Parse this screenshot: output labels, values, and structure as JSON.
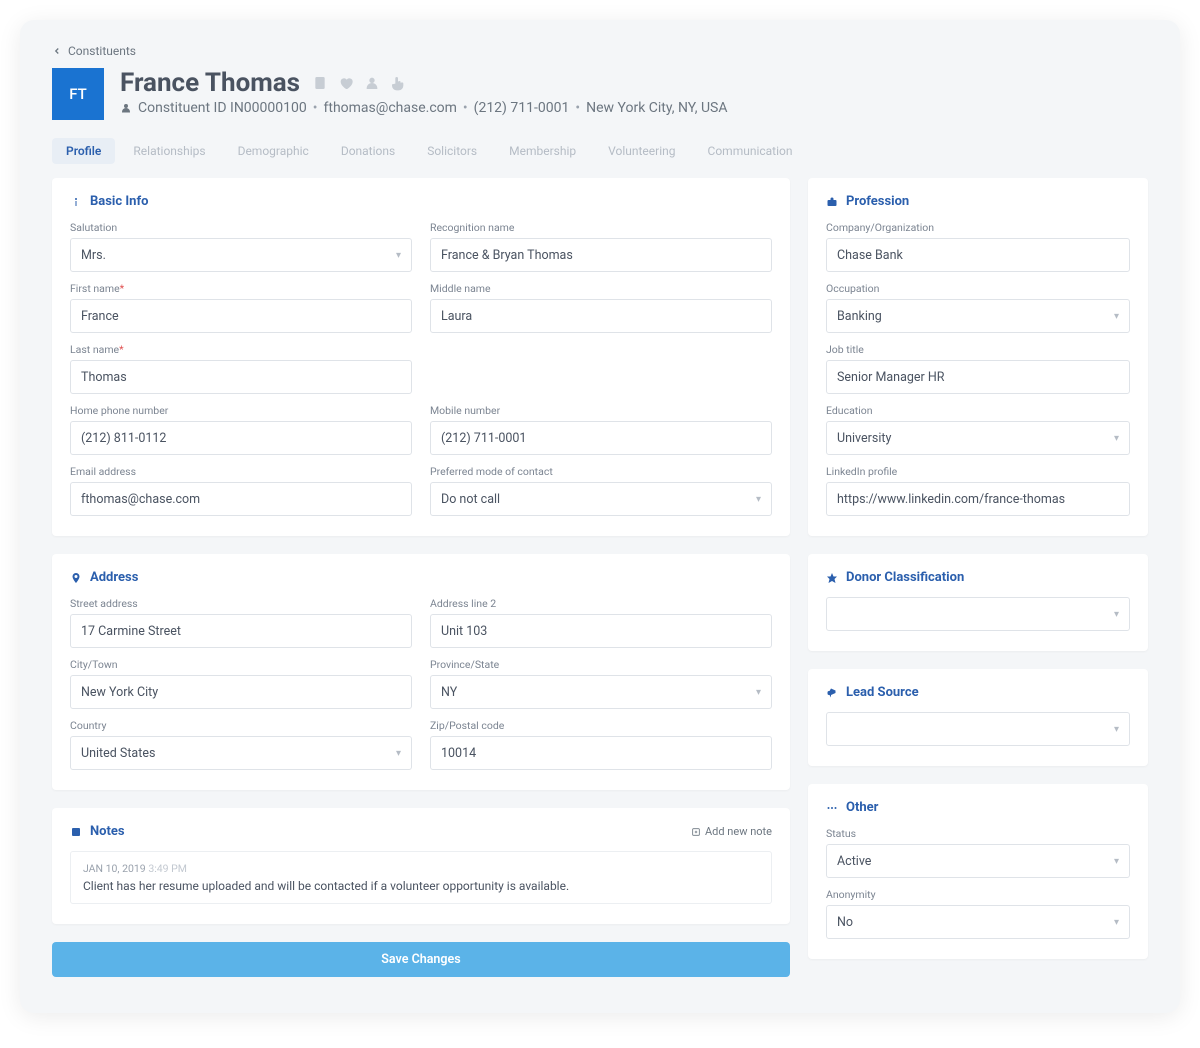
{
  "breadcrumb": "Constituents",
  "avatar_initials": "FT",
  "name": "France Thomas",
  "subheader": {
    "id_label": "Constituent ID IN00000100",
    "email": "fthomas@chase.com",
    "phone": "(212) 711-0001",
    "location": "New York City, NY, USA"
  },
  "tabs": [
    "Profile",
    "Relationships",
    "Demographic",
    "Donations",
    "Solicitors",
    "Membership",
    "Volunteering",
    "Communication"
  ],
  "active_tab": 0,
  "basic": {
    "title": "Basic Info",
    "salutation": {
      "label": "Salutation",
      "value": "Mrs."
    },
    "recognition": {
      "label": "Recognition name",
      "value": "France & Bryan Thomas"
    },
    "first": {
      "label": "First name",
      "value": "France"
    },
    "middle": {
      "label": "Middle name",
      "value": "Laura"
    },
    "last": {
      "label": "Last name",
      "value": "Thomas"
    },
    "homephone": {
      "label": "Home phone number",
      "value": "(212) 811-0112"
    },
    "mobile": {
      "label": "Mobile number",
      "value": "(212) 711-0001"
    },
    "email": {
      "label": "Email address",
      "value": "fthomas@chase.com"
    },
    "contactmode": {
      "label": "Preferred mode of contact",
      "value": "Do not call"
    }
  },
  "address": {
    "title": "Address",
    "street": {
      "label": "Street address",
      "value": "17 Carmine Street"
    },
    "line2": {
      "label": "Address line 2",
      "value": "Unit 103"
    },
    "city": {
      "label": "City/Town",
      "value": "New York City"
    },
    "state": {
      "label": "Province/State",
      "value": "NY"
    },
    "country": {
      "label": "Country",
      "value": "United States"
    },
    "zip": {
      "label": "Zip/Postal code",
      "value": "10014"
    }
  },
  "notes": {
    "title": "Notes",
    "add": "Add new note",
    "date": "JAN 10, 2019",
    "time": "3:49 PM",
    "text": "Client has her resume uploaded and will be contacted if a volunteer opportunity is available."
  },
  "profession": {
    "title": "Profession",
    "company": {
      "label": "Company/Organization",
      "value": "Chase Bank"
    },
    "occupation": {
      "label": "Occupation",
      "value": "Banking"
    },
    "jobtitle": {
      "label": "Job title",
      "value": "Senior Manager HR"
    },
    "education": {
      "label": "Education",
      "value": "University"
    },
    "linkedin": {
      "label": "LinkedIn profile",
      "value": "https://www.linkedin.com/france-thomas"
    }
  },
  "donor": {
    "title": "Donor Classification",
    "value": ""
  },
  "leadsource": {
    "title": "Lead Source",
    "value": ""
  },
  "other": {
    "title": "Other",
    "status": {
      "label": "Status",
      "value": "Active"
    },
    "anonymity": {
      "label": "Anonymity",
      "value": "No"
    }
  },
  "save": "Save Changes"
}
